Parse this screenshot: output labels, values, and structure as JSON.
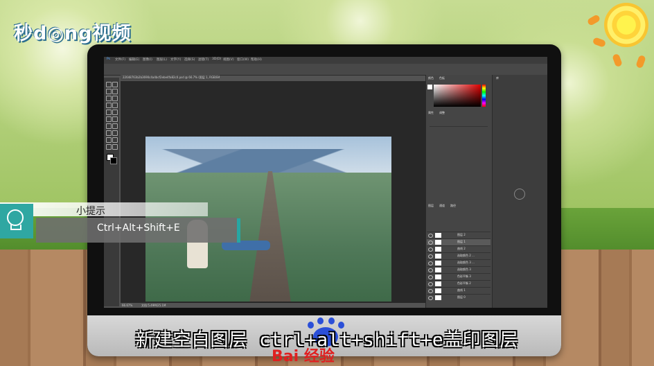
{
  "brand": {
    "logo_text": "秒d◎ng视频"
  },
  "photoshop": {
    "menu": [
      "文件(F)",
      "编辑(E)",
      "图像(I)",
      "图层(L)",
      "文字(Y)",
      "选择(S)",
      "滤镜(T)",
      "3D(D)",
      "视图(V)",
      "窗口(W)",
      "帮助(H)"
    ],
    "doc_tab": "22648763b2b3690c4a4bcf2ebe4fa82c0.psd @ 66.7% (图层 1, RGB/8#)",
    "status_zoom": "66.67%",
    "status_doc": "文档:5.49M/25.1M",
    "panels": {
      "color_tab": "颜色",
      "swatch_tab": "色板",
      "properties_tab": "属性",
      "adjust_tab": "调整",
      "layers_tab": "图层",
      "channels_tab": "通道",
      "paths_tab": "路径",
      "library_hint": "库"
    },
    "layers": [
      "图层 2",
      "图层 1",
      "曲线 2",
      "选取颜色 2 ...",
      "选取颜色 3 ...",
      "选取颜色 3",
      "色彩平衡 3",
      "色彩平衡 2",
      "曲线 1",
      "图层 0"
    ]
  },
  "tip": {
    "heading": "小提示",
    "shortcut": "Ctrl+Alt+Shift+E"
  },
  "subtitle": "新建空白图层 ctrl+alt+shift+e盖印图层",
  "watermark": "Bai 经验",
  "colors": {
    "accent_teal": "#2fa7a2",
    "baidu_blue": "#2b4fd8",
    "baidu_red": "#e02020"
  }
}
